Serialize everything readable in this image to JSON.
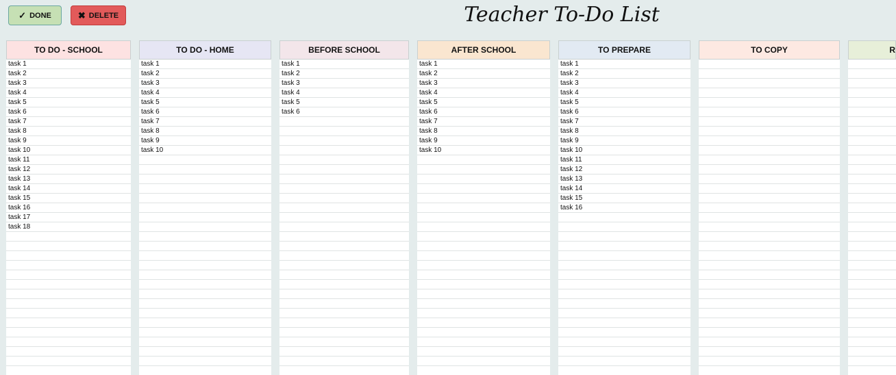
{
  "toolbar": {
    "done_label": "DONE",
    "done_glyph": "✓",
    "delete_label": "DELETE",
    "delete_glyph": "✖"
  },
  "title": "Teacher To-Do List",
  "columns": [
    {
      "title": "TO DO - SCHOOL",
      "color": "#fde2e2",
      "tasks": [
        "task 1",
        "task 2",
        "task 3",
        "task 4",
        "task 5",
        "task 6",
        "task 7",
        "task 8",
        "task 9",
        "task 10",
        "task 11",
        "task 12",
        "task 13",
        "task 14",
        "task 15",
        "task 16",
        "task 17",
        "task 18"
      ]
    },
    {
      "title": "TO DO - HOME",
      "color": "#e6e6f4",
      "tasks": [
        "task 1",
        "task 2",
        "task 3",
        "task 4",
        "task 5",
        "task 6",
        "task 7",
        "task 8",
        "task 9",
        "task 10"
      ]
    },
    {
      "title": "BEFORE SCHOOL",
      "color": "#f3e6ea",
      "tasks": [
        "task 1",
        "task 2",
        "task 3",
        "task 4",
        "task 5",
        "task 6"
      ]
    },
    {
      "title": "AFTER SCHOOL",
      "color": "#fae6d0",
      "tasks": [
        "task 1",
        "task 2",
        "task 3",
        "task 4",
        "task 5",
        "task 6",
        "task 7",
        "task 8",
        "task 9",
        "task 10"
      ]
    },
    {
      "title": "TO PREPARE",
      "color": "#e2eaf3",
      "tasks": [
        "task 1",
        "task 2",
        "task 3",
        "task 4",
        "task 5",
        "task 6",
        "task 7",
        "task 8",
        "task 9",
        "task 10",
        "task 11",
        "task 12",
        "task 13",
        "task 14",
        "task 15",
        "task 16"
      ]
    },
    {
      "title": "TO COPY",
      "color": "#fde9e2",
      "tasks": []
    },
    {
      "title": "R",
      "color": "#e7efd9",
      "tasks": []
    }
  ]
}
